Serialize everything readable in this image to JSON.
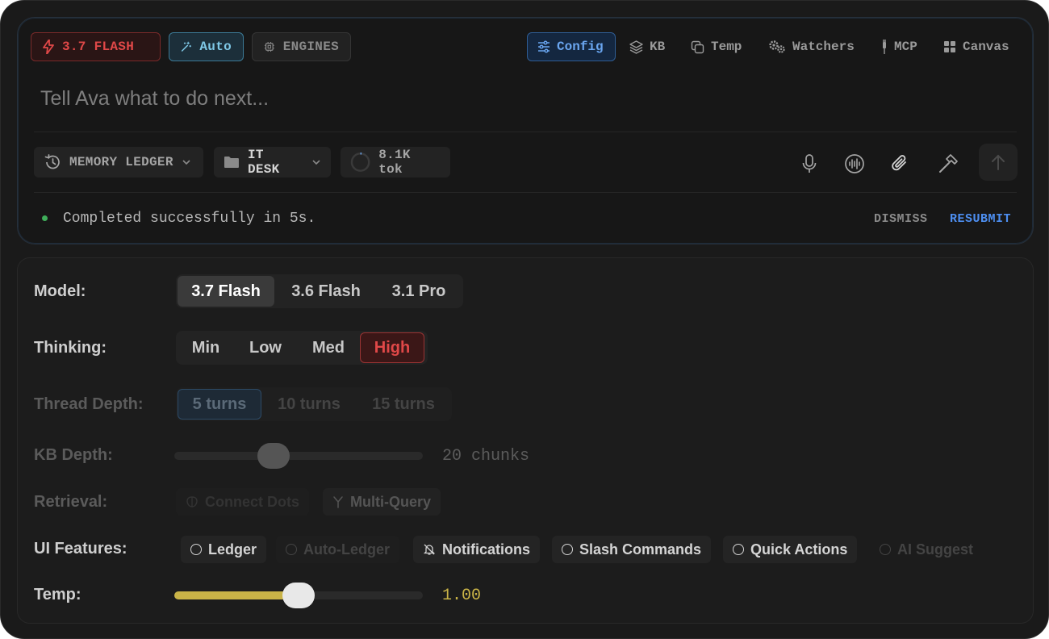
{
  "composer": {
    "model_pill": "3.7 FLASH",
    "auto_pill": "Auto",
    "engines_pill": "ENGINES",
    "nav": {
      "config": "Config",
      "kb": "KB",
      "temp": "Temp",
      "watchers": "Watchers",
      "mcp": "MCP",
      "canvas": "Canvas"
    },
    "placeholder": "Tell Ava what to do next...",
    "chips": {
      "ledger": "MEMORY LEDGER",
      "desk": "IT DESK",
      "tokens": "8.1K tok"
    },
    "status": {
      "text": "Completed successfully in 5s.",
      "dismiss": "DISMISS",
      "resubmit": "RESUBMIT"
    }
  },
  "config": {
    "model": {
      "label": "Model:",
      "options": [
        "3.7 Flash",
        "3.6 Flash",
        "3.1 Pro"
      ],
      "selected": "3.7 Flash"
    },
    "thinking": {
      "label": "Thinking:",
      "options": [
        "Min",
        "Low",
        "Med",
        "High"
      ],
      "selected": "High"
    },
    "thread_depth": {
      "label": "Thread Depth:",
      "options": [
        "5 turns",
        "10 turns",
        "15 turns"
      ],
      "selected": "5 turns"
    },
    "kb_depth": {
      "label": "KB Depth:",
      "value_text": "20 chunks",
      "level": 0.4
    },
    "retrieval": {
      "label": "Retrieval:",
      "options": [
        "Connect Dots",
        "Multi-Query"
      ]
    },
    "ui_features": {
      "label": "UI Features:",
      "items": [
        "Ledger",
        "Auto-Ledger",
        "Notifications",
        "Slash Commands",
        "Quick Actions",
        "AI Suggest"
      ]
    },
    "temp": {
      "label": "Temp:",
      "value_text": "1.00",
      "level": 0.5
    }
  },
  "colors": {
    "accent_blue": "#4d8ef0",
    "accent_red": "#e04848",
    "accent_yellow": "#c9b347",
    "success": "#3fae5a"
  }
}
